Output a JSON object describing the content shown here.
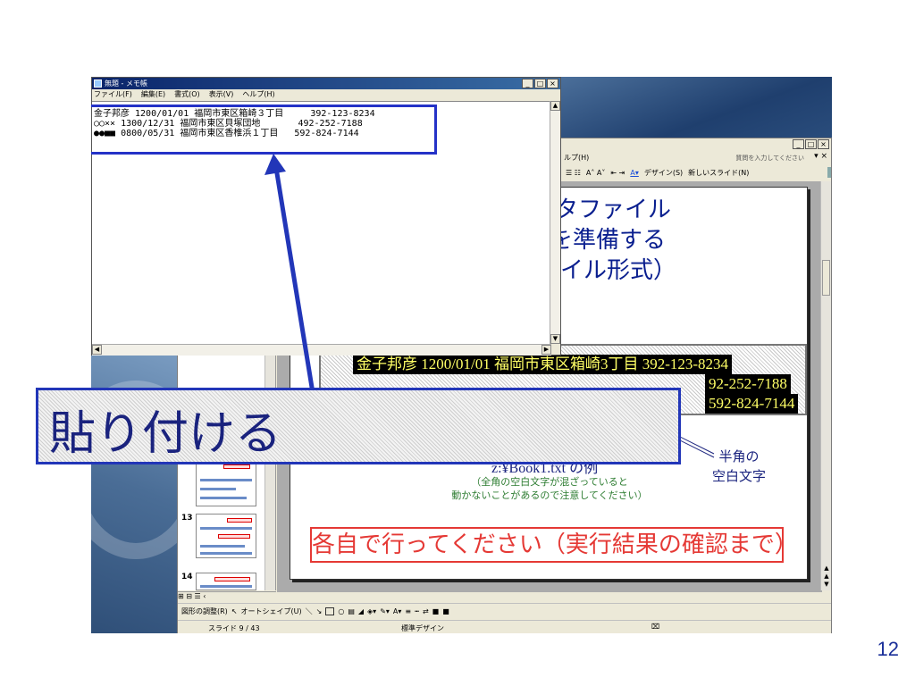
{
  "notepad": {
    "title": "無題 - メモ帳",
    "menu": [
      "ファイル(F)",
      "編集(E)",
      "書式(O)",
      "表示(V)",
      "ヘルプ(H)"
    ],
    "lines": [
      "金子邦彦 1200/01/01 福岡市東区箱崎３丁目     392-123-8234",
      "○○×× 1300/12/31 福岡市東区貝塚団地       492-252-7188",
      "●●■■ 0800/05/31 福岡市東区香椎浜１丁目   592-824-7144"
    ]
  },
  "powerpoint": {
    "menu_help": "ルプ(H)",
    "ask_placeholder": "質問を入力してください",
    "toolbar": {
      "design": "デザイン(S)",
      "new_slide": "新しいスライド(N)"
    },
    "thumbnails": {
      "numbers": [
        "13",
        "14"
      ]
    },
    "draw_bar": {
      "adjust": "図形の調整(R)",
      "autoshape": "オートシェイプ(U)"
    },
    "status": {
      "slide": "スライド 9 / 43",
      "design": "標準デザイン"
    }
  },
  "slide": {
    "title_lines": [
      "タファイル",
      "を準備する",
      "イル形式）"
    ],
    "data_lines": [
      "金子邦彦 1200/01/01 福岡市東区箱崎3丁目    392-123-8234",
      "92-252-7188",
      "592-824-7144"
    ],
    "caption_main": "z:¥Book1.txt の例",
    "caption_note": [
      "（全角の空白文字が混ざっていると",
      "動かないことがあるので注意してください）"
    ],
    "annotation": [
      "半角の",
      "空白文字"
    ],
    "notice": "各自で行ってください（実行結果の確認まで）"
  },
  "banner": {
    "text": "貼り付ける"
  },
  "page_number": "12",
  "colors": {
    "accent_blue": "#2236b8",
    "notice_red": "#e53935",
    "slide_title": "#0a1f8f"
  }
}
